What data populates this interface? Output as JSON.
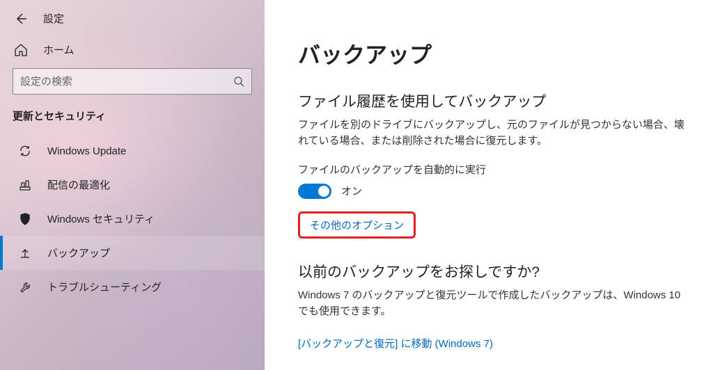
{
  "header": {
    "title": "設定"
  },
  "home": {
    "label": "ホーム"
  },
  "search": {
    "placeholder": "設定の検索"
  },
  "section_label": "更新とセキュリティ",
  "nav": [
    {
      "label": "Windows Update"
    },
    {
      "label": "配信の最適化"
    },
    {
      "label": "Windows セキュリティ"
    },
    {
      "label": "バックアップ"
    },
    {
      "label": "トラブルシューティング"
    }
  ],
  "main": {
    "title": "バックアップ",
    "s1": {
      "heading": "ファイル履歴を使用してバックアップ",
      "desc": "ファイルを別のドライブにバックアップし、元のファイルが見つからない場合、壊れている場合、または削除された場合に復元します。",
      "toggle_label": "ファイルのバックアップを自動的に実行",
      "toggle_state": "オン",
      "more_options": "その他のオプション"
    },
    "s2": {
      "heading": "以前のバックアップをお探しですか?",
      "desc": "Windows 7 のバックアップと復元ツールで作成したバックアップは、Windows 10 でも使用できます。",
      "link": "[バックアップと復元] に移動 (Windows 7)"
    }
  }
}
